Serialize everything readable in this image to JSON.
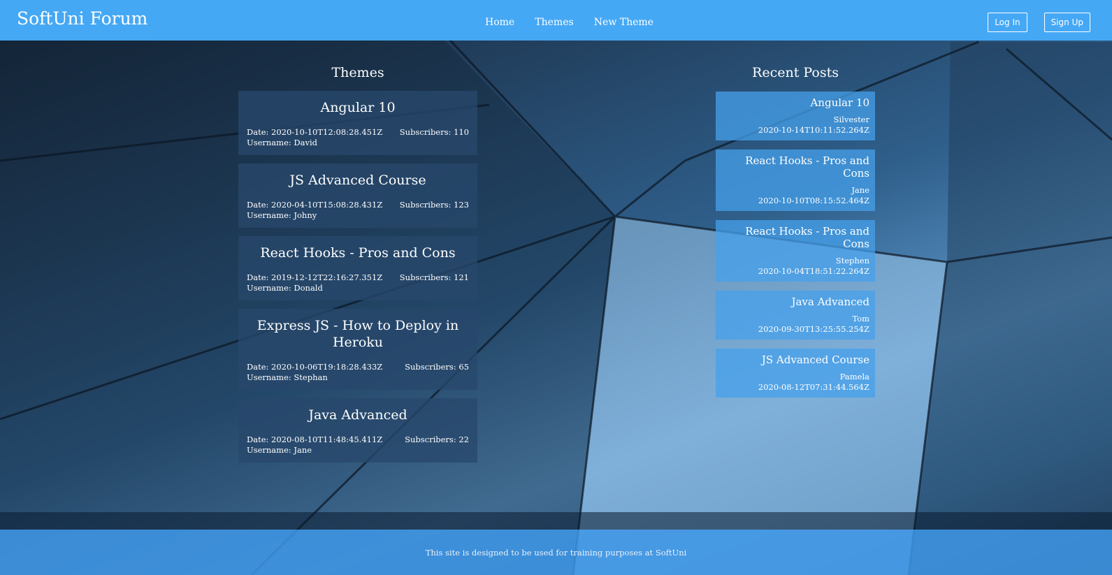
{
  "header": {
    "brand": "SoftUni Forum",
    "nav": [
      "Home",
      "Themes",
      "New Theme"
    ],
    "login_label": "Log In",
    "signup_label": "Sign Up",
    "color": "#45a8f5"
  },
  "themes_section": {
    "title": "Themes",
    "items": [
      {
        "title": "Angular 10",
        "date": "Date: 2020-10-10T12:08:28.451Z",
        "subscribers": "Subscribers: 110",
        "username": "Username: David"
      },
      {
        "title": "JS Advanced Course",
        "date": "Date: 2020-04-10T15:08:28.431Z",
        "subscribers": "Subscribers: 123",
        "username": "Username: Johny"
      },
      {
        "title": "React Hooks - Pros and Cons",
        "date": "Date: 2019-12-12T22:16:27.351Z",
        "subscribers": "Subscribers: 121",
        "username": "Username: Donald"
      },
      {
        "title": "Express JS - How to Deploy in Heroku",
        "date": "Date: 2020-10-06T19:18:28.433Z",
        "subscribers": "Subscribers: 65",
        "username": "Username: Stephan"
      },
      {
        "title": "Java Advanced",
        "date": "Date: 2020-08-10T11:48:45.411Z",
        "subscribers": "Subscribers: 22",
        "username": "Username: Jane"
      }
    ]
  },
  "posts_section": {
    "title": "Recent Posts",
    "items": [
      {
        "title": "Angular 10",
        "author": "Silvester",
        "date": "2020-10-14T10:11:52.264Z"
      },
      {
        "title": "React Hooks - Pros and Cons",
        "author": "Jane",
        "date": "2020-10-10T08:15:52.464Z"
      },
      {
        "title": "React Hooks - Pros and Cons",
        "author": "Stephen",
        "date": "2020-10-04T18:51:22.264Z"
      },
      {
        "title": "Java Advanced",
        "author": "Tom",
        "date": "2020-09-30T13:25:55.254Z"
      },
      {
        "title": "JS Advanced Course",
        "author": "Pamela",
        "date": "2020-08-12T07:31:44.564Z"
      }
    ]
  },
  "footer": {
    "text": "This site is designed to be used for training purposes at SoftUni"
  }
}
